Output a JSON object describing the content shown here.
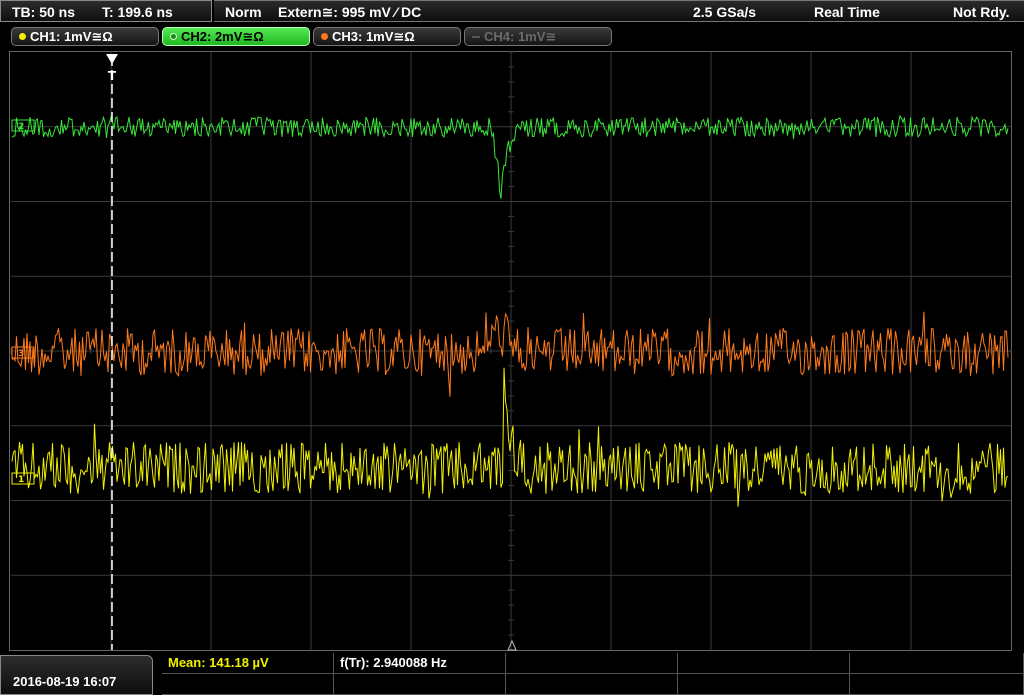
{
  "status_bar": {
    "timebase": "TB: 50 ns",
    "trigger_time": "T: 199.6 ns",
    "trigger_mode": "Norm",
    "trigger_source": "Extern≅: 995 mV ⁄ DC",
    "sample_rate": "2.5 GSa/s",
    "acq_mode": "Real Time",
    "run_state": "Not Rdy."
  },
  "channels": [
    {
      "label": "CH1: 1mV≅Ω",
      "color": "#f0f000",
      "active": false,
      "enabled": true
    },
    {
      "label": "CH2: 2mV≅Ω",
      "color": "#39e639",
      "active": true,
      "enabled": true
    },
    {
      "label": "CH3: 1mV≅Ω",
      "color": "#ff7a1a",
      "active": false,
      "enabled": true
    },
    {
      "label": "CH4: 1mV≅",
      "color": "#666666",
      "active": false,
      "enabled": false
    }
  ],
  "trace_markers": [
    "2",
    "3",
    "1"
  ],
  "trigger_marker": "T",
  "datetime": "2016-08-19 16:07",
  "measurements": {
    "mean": "Mean: 141.18 µV",
    "frequency": "f(Tr): 2.940088 Hz"
  },
  "colors": {
    "ch1": "#f0f000",
    "ch2": "#39e639",
    "ch3": "#ff7a1a",
    "grid": "#3a3a3a",
    "trigger_line": "#ffffff"
  }
}
